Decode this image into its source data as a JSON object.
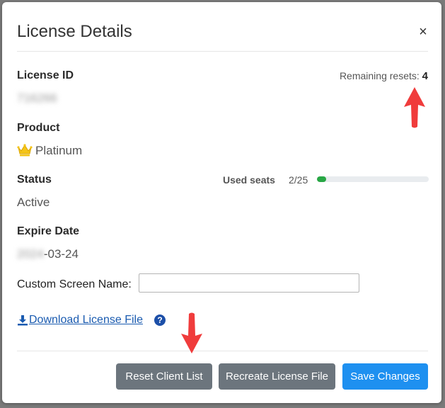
{
  "modal": {
    "title": "License Details",
    "close_glyph": "×"
  },
  "license": {
    "id_label": "License ID",
    "id_value": "716266",
    "remaining_label": "Remaining resets:",
    "remaining_value": "4"
  },
  "product": {
    "label": "Product",
    "value": "Platinum",
    "icon": "crown-icon"
  },
  "status": {
    "label": "Status",
    "value": "Active"
  },
  "seats": {
    "label": "Used seats",
    "count_text": "2/25",
    "used": 2,
    "total": 25
  },
  "expire": {
    "label": "Expire Date",
    "year_blurred": "2024",
    "suffix": "-03-24"
  },
  "custom_name": {
    "label": "Custom Screen Name:",
    "value": "",
    "placeholder": ""
  },
  "download": {
    "label": "Download License File",
    "icon": "download-icon",
    "help_glyph": "?"
  },
  "buttons": {
    "reset": "Reset Client List",
    "recreate": "Recreate License File",
    "save": "Save Changes"
  },
  "colors": {
    "progress_fill": "#28a745",
    "primary": "#1e90f0",
    "secondary": "#6c757d",
    "annotation_arrow": "#f03c3c",
    "link": "#1a5bb0"
  }
}
